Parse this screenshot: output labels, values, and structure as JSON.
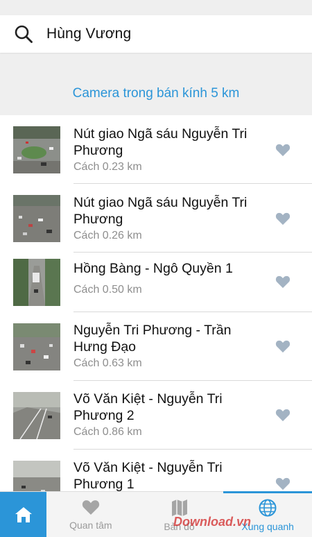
{
  "search": {
    "query": "Hùng Vương"
  },
  "radius_label": "Camera trong bán kính 5 km",
  "cameras": [
    {
      "title": "Nút giao Ngã sáu Nguyễn Tri Phương",
      "distance": "Cách 0.23 km"
    },
    {
      "title": "Nút giao Ngã sáu Nguyễn Tri Phương",
      "distance": "Cách 0.26 km"
    },
    {
      "title": "Hồng Bàng - Ngô Quyền 1",
      "distance": "Cách 0.50 km"
    },
    {
      "title": "Nguyễn Tri Phương - Trần Hưng Đạo",
      "distance": "Cách 0.63 km"
    },
    {
      "title": "Võ Văn Kiệt - Nguyễn Tri Phương 2",
      "distance": "Cách 0.86 km"
    },
    {
      "title": "Võ Văn Kiệt - Nguyễn Tri Phương 1",
      "distance": ""
    }
  ],
  "tabbar": {
    "favorites": "Quan tâm",
    "map": "Bản đồ",
    "nearby": "Xung quanh",
    "active_tab": "nearby"
  },
  "watermark": "Download.vn",
  "colors": {
    "accent": "#2b95d8",
    "heart": "#a3b3c3",
    "text_secondary": "#8e8e8e"
  },
  "icons": [
    "search-icon",
    "heart-icon",
    "home-icon",
    "map-icon",
    "globe-icon"
  ]
}
